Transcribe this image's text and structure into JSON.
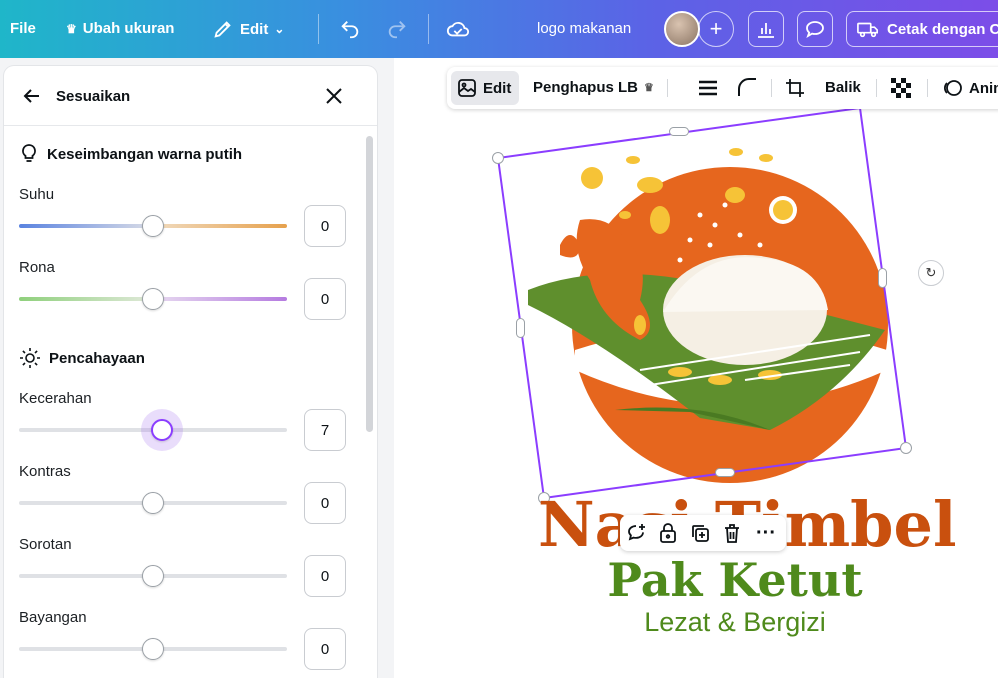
{
  "topbar": {
    "file": "File",
    "resize": "Ubah ukuran",
    "edit": "Edit",
    "title": "logo makanan",
    "print": "Cetak dengan C"
  },
  "panel": {
    "title": "Sesuaikan",
    "white_balance": {
      "heading": "Keseimbangan warna putih",
      "sliders": [
        {
          "label": "Suhu",
          "value": "0"
        },
        {
          "label": "Rona",
          "value": "0"
        }
      ]
    },
    "lighting": {
      "heading": "Pencahayaan",
      "sliders": [
        {
          "label": "Kecerahan",
          "value": "7"
        },
        {
          "label": "Kontras",
          "value": "0"
        },
        {
          "label": "Sorotan",
          "value": "0"
        },
        {
          "label": "Bayangan",
          "value": "0"
        }
      ]
    }
  },
  "toolbar": {
    "edit": "Edit",
    "bg_remover": "Penghapus LB",
    "flip": "Balik",
    "animate": "Anim"
  },
  "design": {
    "line1": "Nasi Timbel",
    "line2": "Pak Ketut",
    "line3": "Lezat & Bergizi"
  },
  "colors": {
    "accent": "#7d2ae8",
    "orange": "#e6661e",
    "title_orange": "#c9500e",
    "green": "#4f8a1c"
  }
}
